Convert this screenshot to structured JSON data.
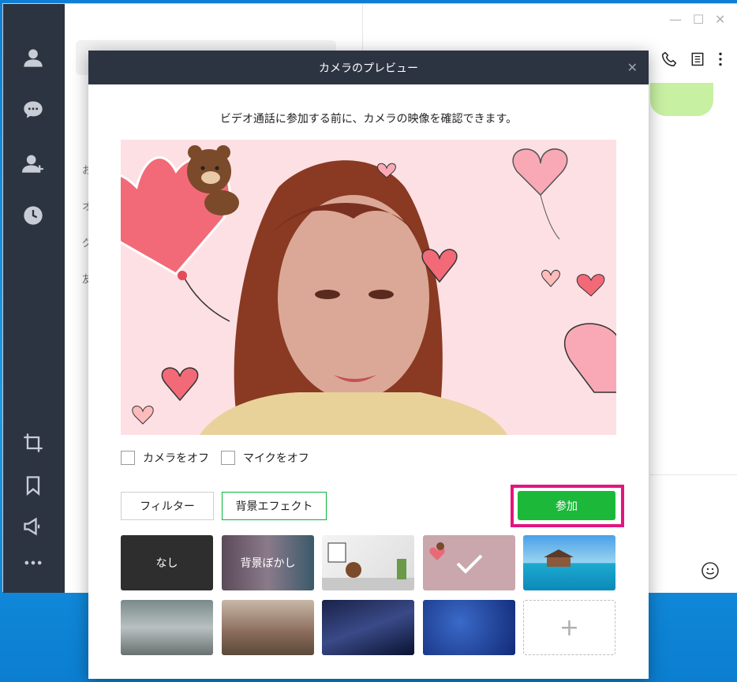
{
  "dialog": {
    "title": "カメラのプレビュー",
    "description": "ビデオ通話に参加する前に、カメラの映像を確認できます。",
    "camera_off_label": "カメラをオフ",
    "mic_off_label": "マイクをオフ",
    "filter_tab_label": "フィルター",
    "background_tab_label": "背景エフェクト",
    "join_label": "参加",
    "backgrounds": [
      {
        "label": "なし"
      },
      {
        "label": "背景ぼかし"
      },
      {
        "label": ""
      },
      {
        "label": "",
        "selected": true
      },
      {
        "label": ""
      },
      {
        "label": ""
      },
      {
        "label": ""
      },
      {
        "label": ""
      },
      {
        "label": ""
      },
      {
        "label": "+"
      }
    ]
  },
  "list_panel": {
    "items": [
      "お",
      "オ",
      "グ",
      "友"
    ]
  },
  "colors": {
    "sidebar": "#2c3442",
    "accent_green": "#1cb83a",
    "highlight": "#e3157f"
  }
}
